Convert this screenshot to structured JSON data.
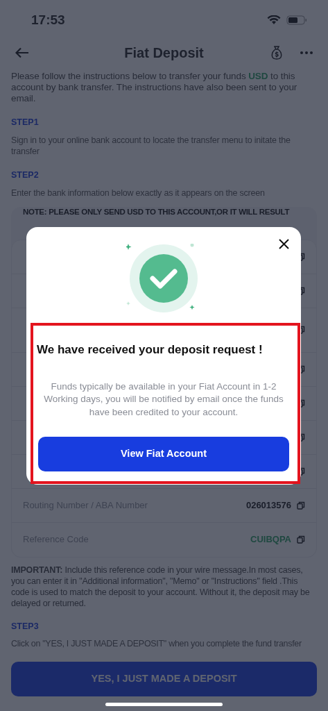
{
  "status_bar": {
    "time": "17:53"
  },
  "header": {
    "title": "Fiat Deposit"
  },
  "intro": {
    "before": "Please follow the instructions below to transfer your funds ",
    "currency": "USD",
    "after": " to this account by bank transfer. The instructions have also been sent to your email."
  },
  "steps": [
    {
      "label": "STEP1",
      "text": "Sign in to your online bank account to locate the transfer menu to initate the transfer"
    },
    {
      "label": "STEP2",
      "text": "Enter the bank information below exactly as it appears on the screen"
    }
  ],
  "note": "NOTE: PLEASE ONLY SEND USD TO THIS ACCOUNT,OR IT WILL RESULT",
  "details": [
    {
      "kind": "covered"
    },
    {
      "kind": "covered"
    },
    {
      "kind": "covered"
    },
    {
      "kind": "covered"
    },
    {
      "kind": "covered"
    },
    {
      "kind": "covered"
    },
    {
      "kind": "covered"
    },
    {
      "kind": "field",
      "label": "Routing Number / ABA Number",
      "value": "026013576",
      "accent": false
    },
    {
      "kind": "field",
      "label": "Reference Code",
      "value": "CUIBQPA",
      "accent": true
    }
  ],
  "important": "**IMPORTANT:** Include this reference code in your wire message.In most cases, you can enter it in \"Additional information\", \"Memo\" or \"Instructions\" field .This code is used to match the deposit to your account. Without it, the deposit may be delayed or returned.",
  "step3": {
    "label": "STEP3",
    "text": "Click on \"YES, I JUST MADE A DEPOSIT\" when you complete the fund transfer"
  },
  "deposit_button": "YES, I JUST MADE A DEPOSIT",
  "modal": {
    "title": "We have received your deposit request !",
    "message": "Funds typically be available in your Fiat Account in 1-2 Working days, you will be notified by email once the funds have been credited to your account.",
    "button": "View Fiat Account"
  }
}
